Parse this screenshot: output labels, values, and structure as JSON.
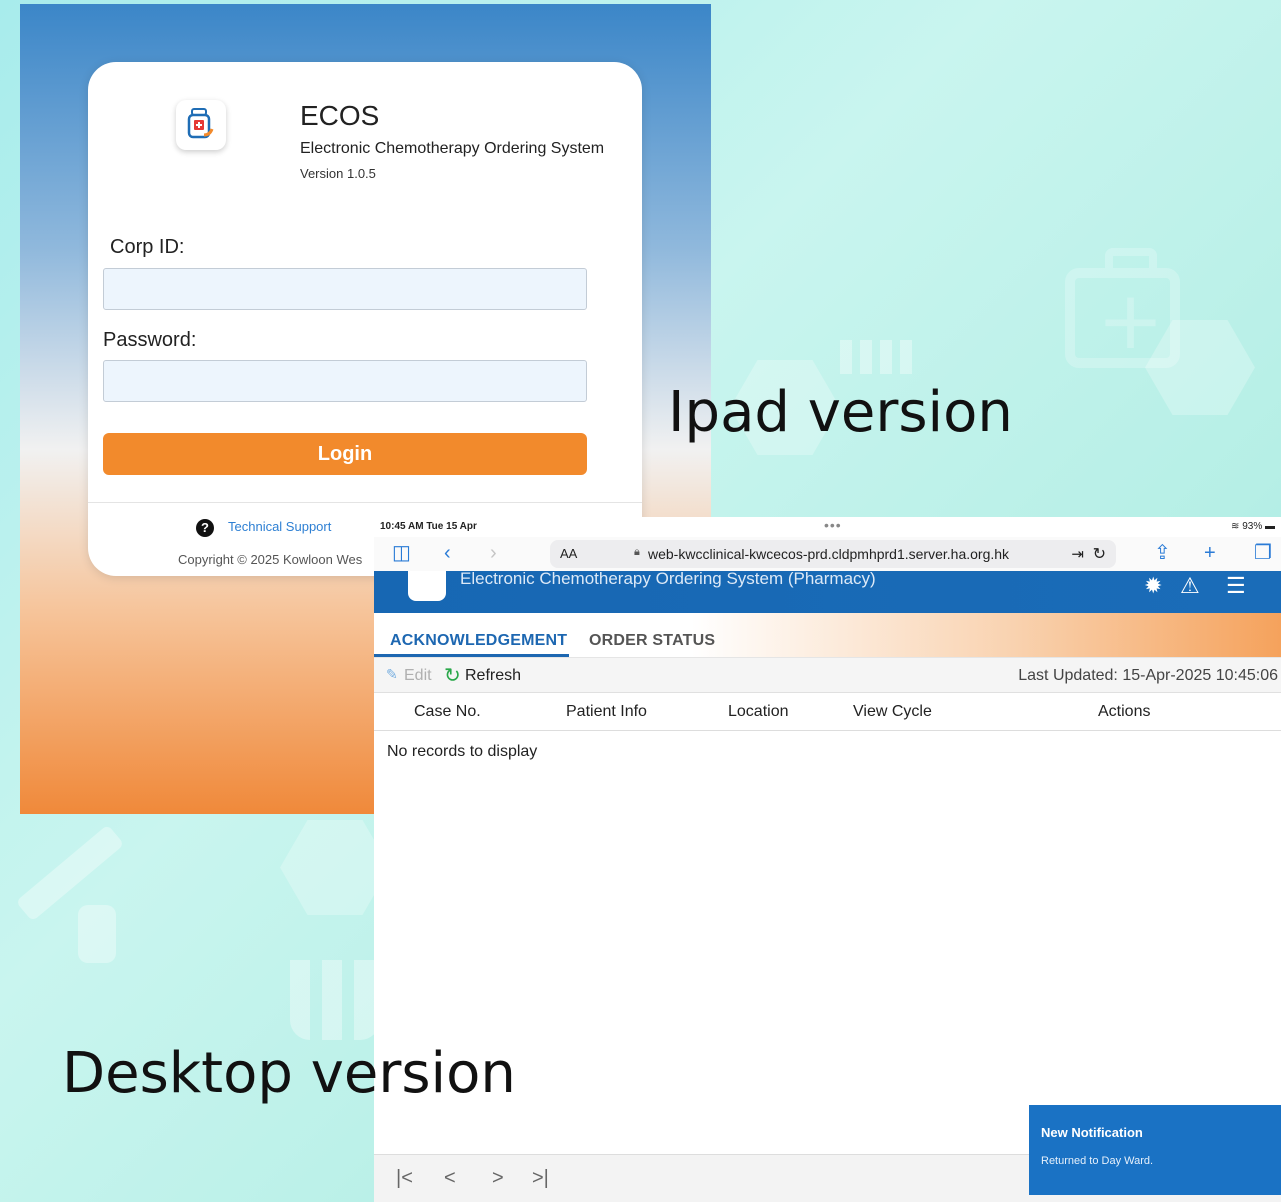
{
  "labels": {
    "ipad": "Ipad version",
    "desktop": "Desktop version"
  },
  "login": {
    "app_name": "ECOS",
    "app_subtitle": "Electronic Chemotherapy Ordering System",
    "version": "Version 1.0.5",
    "corp_id_label": "Corp ID:",
    "corp_id_value": "",
    "password_label": "Password:",
    "password_value": "",
    "login_button": "Login",
    "help_icon": "?",
    "technical_support": "Technical Support",
    "copyright": "Copyright © 2025 Kowloon Wes"
  },
  "ipad_status": {
    "time": "10:45 AM  Tue 15 Apr",
    "dots": "•••",
    "battery": "93%"
  },
  "browser": {
    "aa_label": "AA",
    "url": "web-kwcclinical-kwcecos-prd.cldpmhprd1.server.ha.org.hk",
    "icons": [
      "sidebar-icon",
      "back-icon",
      "forward-icon",
      "reader-icon",
      "reload-icon",
      "share-icon",
      "add-tab-icon",
      "tabs-icon"
    ]
  },
  "app": {
    "header_title": "Electronic Chemotherapy Ordering System (Pharmacy)",
    "tabs": [
      {
        "label": "ACKNOWLEDGEMENT",
        "active": true
      },
      {
        "label": "ORDER STATUS",
        "active": false
      }
    ],
    "toolbar": {
      "edit_label": "Edit",
      "refresh_label": "Refresh",
      "last_updated": "Last Updated: 15-Apr-2025 10:45:06"
    },
    "columns": [
      "Case No.",
      "Patient Info",
      "Location",
      "View Cycle",
      "Actions"
    ],
    "empty_message": "No records to display",
    "pager": [
      "|<",
      "<",
      ">",
      ">|"
    ],
    "notification": {
      "title": "New Notification",
      "message": "Returned to Day Ward."
    }
  },
  "colors": {
    "accent_blue": "#1767b3",
    "login_orange": "#f28a2c",
    "link_blue": "#2d7fd3",
    "refresh_green": "#2aa84a"
  }
}
